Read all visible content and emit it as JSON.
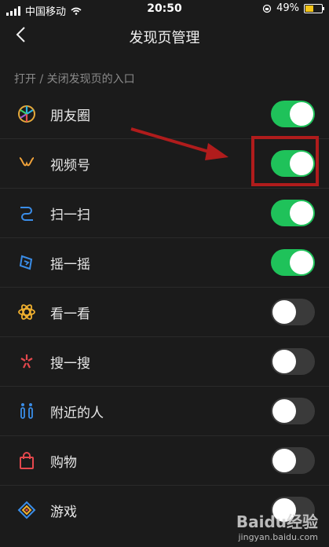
{
  "status": {
    "carrier": "中国移动",
    "time": "20:50",
    "battery": "49%",
    "battery_level": 0.49
  },
  "header": {
    "title": "发现页管理"
  },
  "subtitle": "打开 / 关闭发现页的入口",
  "items": [
    {
      "label": "朋友圈",
      "icon": "moments-icon",
      "on": true
    },
    {
      "label": "视频号",
      "icon": "channels-icon",
      "on": true
    },
    {
      "label": "扫一扫",
      "icon": "scan-icon",
      "on": true
    },
    {
      "label": "摇一摇",
      "icon": "shake-icon",
      "on": true
    },
    {
      "label": "看一看",
      "icon": "top-stories-icon",
      "on": false
    },
    {
      "label": "搜一搜",
      "icon": "search-icon",
      "on": false
    },
    {
      "label": "附近的人",
      "icon": "people-nearby-icon",
      "on": false
    },
    {
      "label": "购物",
      "icon": "shopping-bag-icon",
      "on": false
    },
    {
      "label": "游戏",
      "icon": "games-icon",
      "on": false
    }
  ],
  "watermark": {
    "brand": "Baidu经验",
    "url": "jingyan.baidu.com"
  }
}
